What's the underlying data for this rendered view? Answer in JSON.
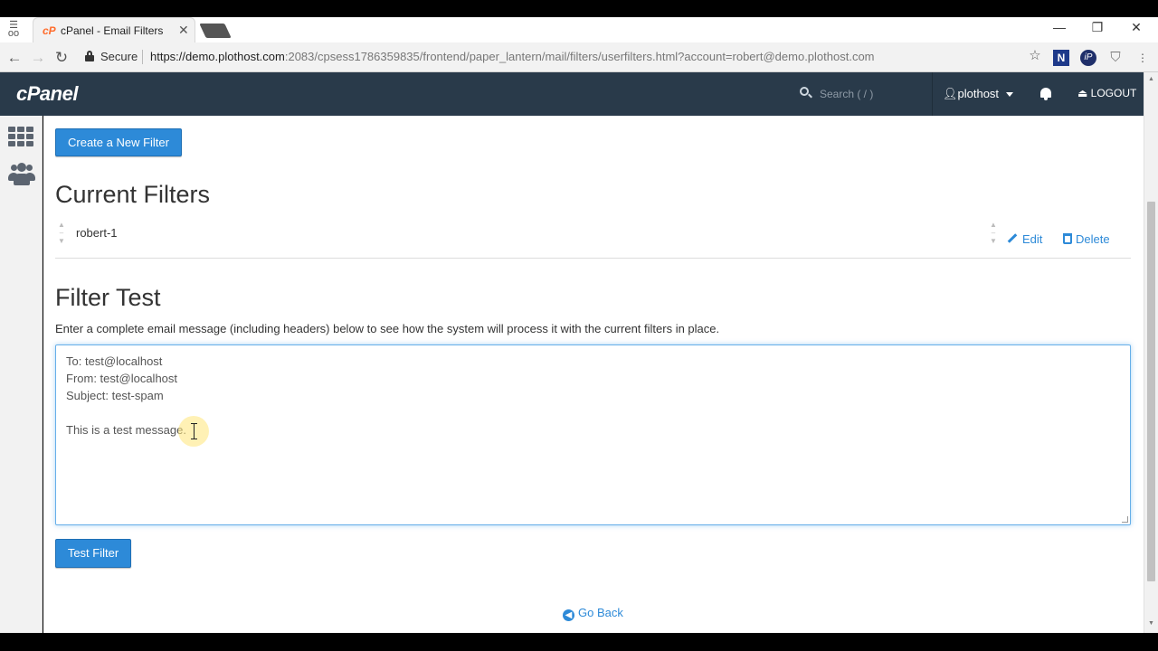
{
  "browser": {
    "tab_title": "cPanel - Email Filters",
    "tab_favicon": "cP",
    "secure_label": "Secure",
    "url_host": "https://demo.plothost.com",
    "url_rest": ":2083/cpsess1786359835/frontend/paper_lantern/mail/filters/userfilters.html?account=robert@demo.plothost.com"
  },
  "header": {
    "logo": "cPanel",
    "search_placeholder": "Search ( / )",
    "username": "plothost",
    "logout_label": "LOGOUT"
  },
  "main": {
    "create_button": "Create a New Filter",
    "current_filters_title": "Current Filters",
    "filters": [
      {
        "name": "robert-1",
        "edit_label": "Edit",
        "delete_label": "Delete"
      }
    ],
    "filter_test_title": "Filter Test",
    "filter_test_description": "Enter a complete email message (including headers) below to see how the system will process it with the current filters in place.",
    "message_lines": [
      "To: test@localhost",
      "From: test@localhost",
      "Subject: test-spam",
      "",
      "This is a test message."
    ],
    "test_button": "Test Filter",
    "go_back": "Go Back"
  },
  "colors": {
    "header_bg": "#293a4a",
    "accent": "#2d8ad8"
  }
}
